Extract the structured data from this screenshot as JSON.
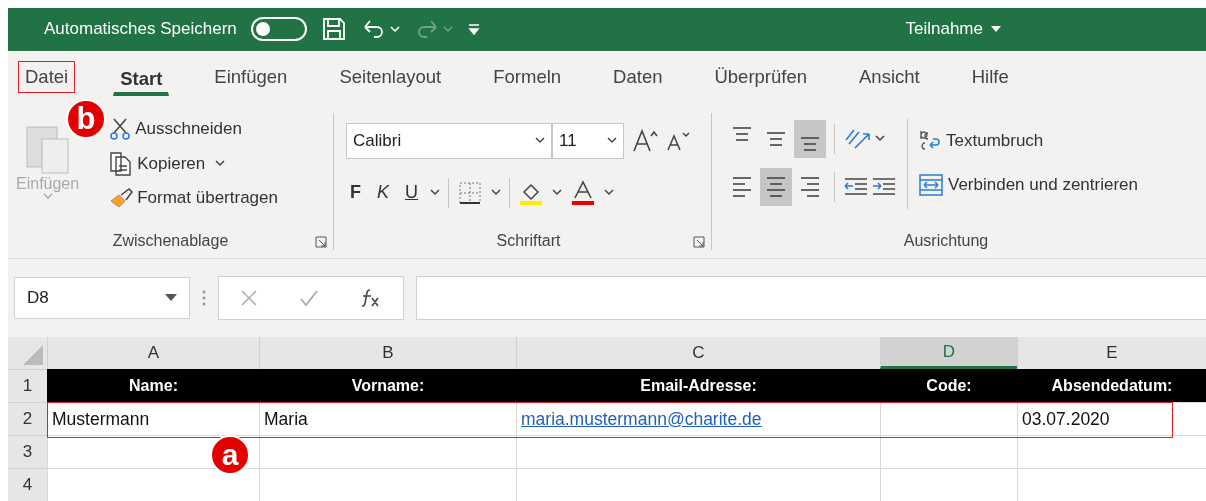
{
  "title_bar": {
    "autosave_label": "Automatisches Speichern",
    "autosave_on": false,
    "redo_disabled": true,
    "title": "Teilnahme"
  },
  "tabs": [
    {
      "label": "Datei",
      "selected": false,
      "highlighted": true
    },
    {
      "label": "Start",
      "selected": true,
      "highlighted": false
    },
    {
      "label": "Einfügen",
      "selected": false,
      "highlighted": false
    },
    {
      "label": "Seitenlayout",
      "selected": false,
      "highlighted": false
    },
    {
      "label": "Formeln",
      "selected": false,
      "highlighted": false
    },
    {
      "label": "Daten",
      "selected": false,
      "highlighted": false
    },
    {
      "label": "Überprüfen",
      "selected": false,
      "highlighted": false
    },
    {
      "label": "Ansicht",
      "selected": false,
      "highlighted": false
    },
    {
      "label": "Hilfe",
      "selected": false,
      "highlighted": false
    }
  ],
  "ribbon": {
    "clipboard": {
      "paste_label": "Einfügen",
      "paste_disabled": true,
      "cut": "Ausschneiden",
      "copy": "Kopieren",
      "format_painter": "Format übertragen",
      "name": "Zwischenablage"
    },
    "font": {
      "font_name": "Calibri",
      "font_size": "11",
      "bold": "F",
      "italic": "K",
      "underline": "U",
      "name": "Schriftart"
    },
    "alignment": {
      "vertical": [
        {
          "selected": false
        },
        {
          "selected": false
        },
        {
          "selected": true
        }
      ],
      "horizontal": [
        {
          "selected": false
        },
        {
          "selected": true
        },
        {
          "selected": false
        }
      ],
      "wrap_text": "Textumbruch",
      "merge": "Verbinden und zentrieren",
      "name": "Ausrichtung"
    }
  },
  "formula_bar": {
    "name_box": "D8"
  },
  "sheet": {
    "columns": [
      {
        "label": "A",
        "selected": false
      },
      {
        "label": "B",
        "selected": false
      },
      {
        "label": "C",
        "selected": false
      },
      {
        "label": "D",
        "selected": true
      },
      {
        "label": "E",
        "selected": false
      }
    ],
    "rows": [
      {
        "number": "1",
        "highlighted": false,
        "cells": [
          {
            "kind": "header",
            "text": "Name:"
          },
          {
            "kind": "header",
            "text": "Vorname:"
          },
          {
            "kind": "header",
            "text": "Email-Adresse:"
          },
          {
            "kind": "header",
            "text": "Code:"
          },
          {
            "kind": "header",
            "text": "Absendedatum:"
          }
        ]
      },
      {
        "number": "2",
        "highlighted": true,
        "cells": [
          {
            "kind": "text",
            "text": "Mustermann"
          },
          {
            "kind": "text",
            "text": "Maria"
          },
          {
            "kind": "link",
            "text": "maria.mustermann@charite.de"
          },
          {
            "kind": "empty"
          },
          {
            "kind": "text",
            "text": "03.07.2020"
          }
        ]
      },
      {
        "number": "3",
        "highlighted": false,
        "cells": [
          {
            "kind": "empty"
          },
          {
            "kind": "empty"
          },
          {
            "kind": "empty"
          },
          {
            "kind": "empty"
          },
          {
            "kind": "empty"
          }
        ]
      },
      {
        "number": "4",
        "highlighted": false,
        "cells": [
          {
            "kind": "empty"
          },
          {
            "kind": "empty"
          },
          {
            "kind": "empty"
          },
          {
            "kind": "empty"
          },
          {
            "kind": "empty"
          }
        ]
      }
    ]
  },
  "annotations": {
    "tab_marker": "b",
    "row_marker": "a"
  }
}
